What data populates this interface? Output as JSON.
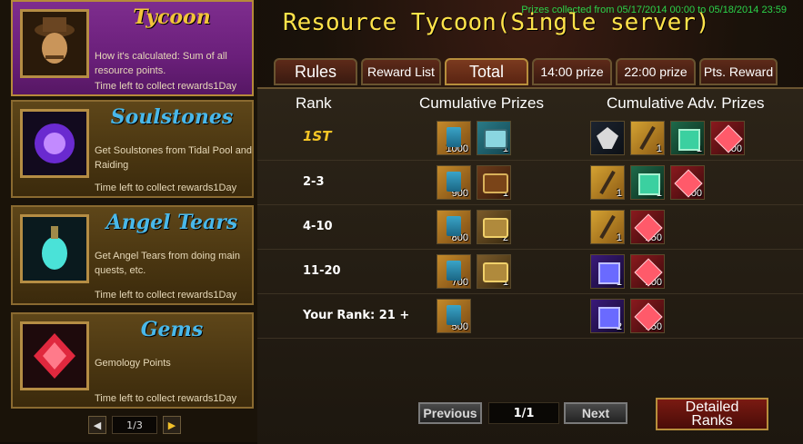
{
  "sidebar": {
    "cards": [
      {
        "title": "Tycoon",
        "desc": "How it's calculated: Sum of all resource points.",
        "time": "Time left to collect rewards1Day"
      },
      {
        "title": "Soulstones",
        "desc": "Get Soulstones from Tidal Pool and Raiding",
        "time": "Time left to collect rewards1Day"
      },
      {
        "title": "Angel Tears",
        "desc": "Get Angel Tears from doing main quests, etc.",
        "time": "Time left to collect rewards1Day"
      },
      {
        "title": "Gems",
        "desc": "Gemology Points",
        "time": "Time left to collect rewards1Day"
      }
    ],
    "page": "1/3",
    "prev": "◀",
    "next": "▶"
  },
  "header": {
    "collected": "Prizes collected from 05/17/2014 00:00 to 05/18/2014 23:59",
    "title": "Resource Tycoon(Single server)"
  },
  "tabs": [
    "Rules",
    "Reward List",
    "Total",
    "14:00 prize",
    "22:00 prize",
    "Pts. Reward"
  ],
  "table": {
    "headers": {
      "rank": "Rank",
      "cumulative": "Cumulative Prizes",
      "adv": "Cumulative Adv. Prizes"
    },
    "rows": [
      {
        "rank": "1ST",
        "cum": [
          {
            "icon": "scroll-icon",
            "q": "1000"
          },
          {
            "icon": "blue-chest-icon",
            "q": "1"
          }
        ],
        "adv": [
          {
            "icon": "eagle-icon",
            "q": ""
          },
          {
            "icon": "weapon-icon",
            "q": "1"
          },
          {
            "icon": "green-gem-icon",
            "q": "1"
          },
          {
            "icon": "red-gem-icon",
            "q": "300"
          }
        ]
      },
      {
        "rank": "2-3",
        "cum": [
          {
            "icon": "scroll-icon",
            "q": "900"
          },
          {
            "icon": "chest-icon",
            "q": "1"
          }
        ],
        "adv": [
          {
            "icon": "weapon-icon",
            "q": "1"
          },
          {
            "icon": "green-gem-icon",
            "q": "1"
          },
          {
            "icon": "red-gem-icon",
            "q": "300"
          }
        ]
      },
      {
        "rank": "4-10",
        "cum": [
          {
            "icon": "scroll-icon",
            "q": "800"
          },
          {
            "icon": "gold-chest-icon",
            "q": "2"
          }
        ],
        "adv": [
          {
            "icon": "weapon-icon",
            "q": "1"
          },
          {
            "icon": "red-gem-icon",
            "q": "250"
          }
        ]
      },
      {
        "rank": "11-20",
        "cum": [
          {
            "icon": "scroll-icon",
            "q": "700"
          },
          {
            "icon": "gold-chest-icon",
            "q": "1"
          }
        ],
        "adv": [
          {
            "icon": "purple-gem-icon",
            "q": "1"
          },
          {
            "icon": "red-gem-icon",
            "q": "200"
          }
        ]
      },
      {
        "rank": "Your Rank: 21 +",
        "cum": [
          {
            "icon": "scroll-icon",
            "q": "500"
          }
        ],
        "adv": [
          {
            "icon": "purple-gem-icon",
            "q": "2"
          },
          {
            "icon": "red-gem-icon",
            "q": "150"
          }
        ]
      }
    ]
  },
  "pager": {
    "previous": "Previous",
    "page": "1/1",
    "next": "Next"
  },
  "detailed": {
    "line1": "Detailed",
    "line2": "Ranks"
  }
}
